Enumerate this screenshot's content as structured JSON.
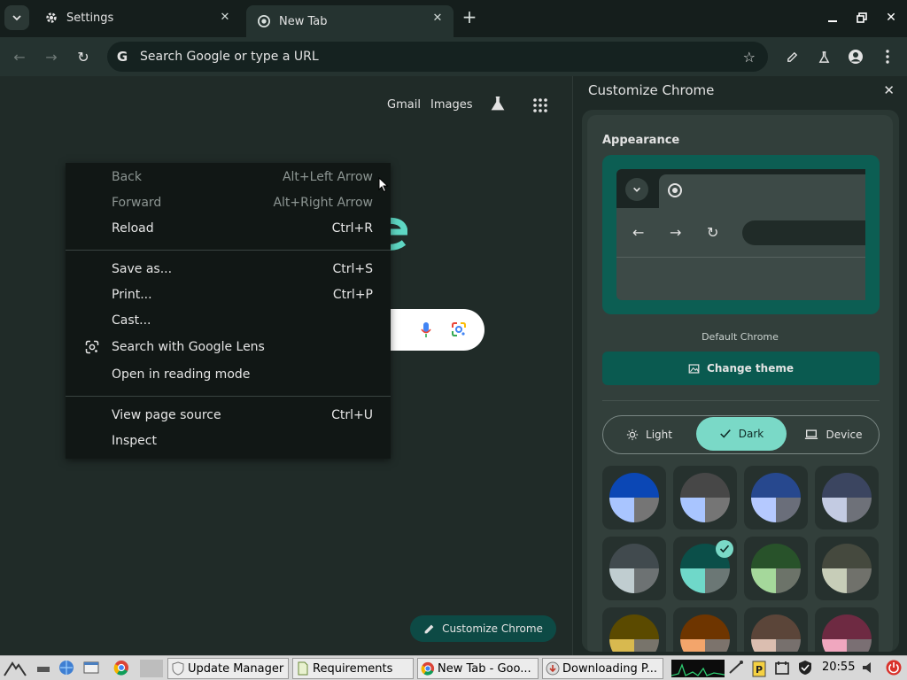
{
  "tabs": [
    {
      "title": "Settings",
      "active": false
    },
    {
      "title": "New Tab",
      "active": true
    }
  ],
  "omnibox": {
    "placeholder": "Search Google or type a URL"
  },
  "ntp": {
    "links": {
      "gmail": "Gmail",
      "images": "Images"
    },
    "customize_label": "Customize Chrome"
  },
  "context_menu": {
    "groups": [
      [
        {
          "label": "Back",
          "shortcut": "Alt+Left Arrow",
          "disabled": true
        },
        {
          "label": "Forward",
          "shortcut": "Alt+Right Arrow",
          "disabled": true
        },
        {
          "label": "Reload",
          "shortcut": "Ctrl+R",
          "disabled": false
        }
      ],
      [
        {
          "label": "Save as...",
          "shortcut": "Ctrl+S",
          "disabled": false
        },
        {
          "label": "Print...",
          "shortcut": "Ctrl+P",
          "disabled": false
        },
        {
          "label": "Cast...",
          "shortcut": "",
          "disabled": false
        },
        {
          "label": "Search with Google Lens",
          "shortcut": "",
          "disabled": false,
          "icon": "lens-icon"
        },
        {
          "label": "Open in reading mode",
          "shortcut": "",
          "disabled": false
        }
      ],
      [
        {
          "label": "View page source",
          "shortcut": "Ctrl+U",
          "disabled": false
        },
        {
          "label": "Inspect",
          "shortcut": "",
          "disabled": false
        }
      ]
    ]
  },
  "side_panel": {
    "title": "Customize Chrome",
    "appearance_heading": "Appearance",
    "theme_name": "Default Chrome",
    "change_theme_label": "Change theme",
    "modes": [
      {
        "label": "Light",
        "selected": false,
        "icon": "sun-icon"
      },
      {
        "label": "Dark",
        "selected": true,
        "icon": "check-icon"
      },
      {
        "label": "Device",
        "selected": false,
        "icon": "laptop-icon"
      }
    ],
    "swatches": [
      {
        "top": "#0b47b5",
        "bl": "#a9c5ff",
        "br": "#757575",
        "selected": false
      },
      {
        "top": "#474747",
        "bl": "#a9c5ff",
        "br": "#757575",
        "selected": false
      },
      {
        "top": "#27488e",
        "bl": "#b5c9ff",
        "br": "#6a6e7a",
        "selected": false
      },
      {
        "top": "#3b4560",
        "bl": "#c3cbe2",
        "br": "#6e7179",
        "selected": false
      },
      {
        "top": "#414a4e",
        "bl": "#c0cdd0",
        "br": "#6d7273",
        "selected": false
      },
      {
        "top": "#0b4f49",
        "bl": "#6fd8c9",
        "br": "#6b7775",
        "selected": true
      },
      {
        "top": "#28522a",
        "bl": "#a5d89b",
        "br": "#6c7369",
        "selected": false
      },
      {
        "top": "#45493e",
        "bl": "#c7cdb8",
        "br": "#70716b",
        "selected": false
      },
      {
        "top": "#5b4a00",
        "bl": "#d8b94f",
        "br": "#78746b",
        "selected": false
      },
      {
        "top": "#6e3500",
        "bl": "#f3a56b",
        "br": "#7c736c",
        "selected": false
      },
      {
        "top": "#5b4539",
        "bl": "#dbbeb0",
        "br": "#77706d",
        "selected": false
      },
      {
        "top": "#6e2a42",
        "bl": "#f0a7bf",
        "br": "#7a6f73",
        "selected": false
      }
    ]
  },
  "taskbar": {
    "tasks": [
      {
        "label": "Update Manager"
      },
      {
        "label": "Requirements"
      },
      {
        "label": "New Tab - Goo..."
      },
      {
        "label": "Downloading P..."
      }
    ],
    "clock": "20:55"
  },
  "colors": {
    "accent": "#7ad9c7",
    "panel": "#1e2926",
    "menu": "#111715"
  }
}
